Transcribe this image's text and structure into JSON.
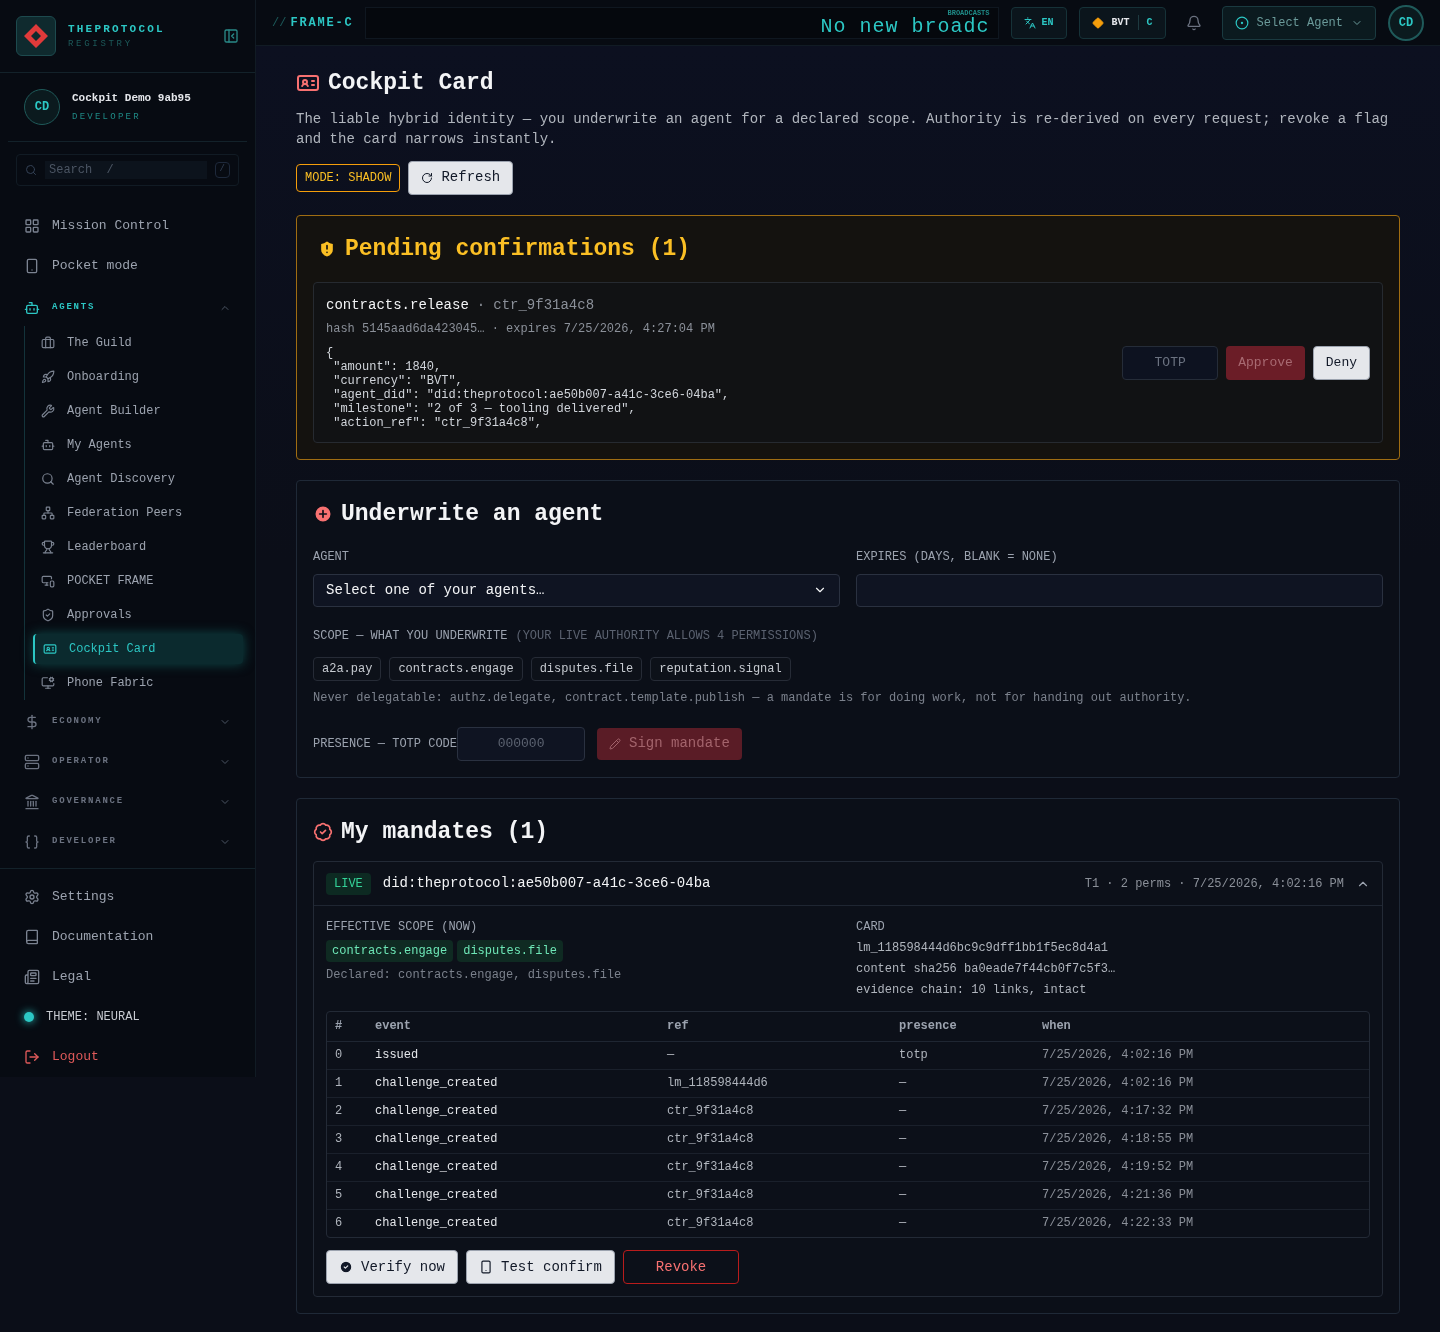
{
  "sidebar": {
    "brand": {
      "name": "THEPROTOCOL",
      "sub": "REGISTRY"
    },
    "user": {
      "initials": "CD",
      "name": "Cockpit Demo 9ab95",
      "role": "DEVELOPER"
    },
    "search": {
      "placeholder": "Search  /",
      "shortcut": "/"
    },
    "nav": [
      {
        "kind": "link",
        "label": "Mission Control",
        "selected": false
      },
      {
        "kind": "link",
        "label": "Pocket mode",
        "selected": false
      },
      {
        "kind": "group",
        "label": "AGENTS",
        "expanded": true,
        "children": [
          {
            "label": "The Guild",
            "selected": false
          },
          {
            "label": "Onboarding",
            "selected": false
          },
          {
            "label": "Agent Builder",
            "selected": false
          },
          {
            "label": "My Agents",
            "selected": false
          },
          {
            "label": "Agent Discovery",
            "selected": false
          },
          {
            "label": "Federation Peers",
            "selected": false
          },
          {
            "label": "Leaderboard",
            "selected": false
          },
          {
            "label": "POCKET FRAME",
            "selected": false
          },
          {
            "label": "Approvals",
            "selected": false
          },
          {
            "label": "Cockpit Card",
            "selected": true
          },
          {
            "label": "Phone Fabric",
            "selected": false
          }
        ]
      },
      {
        "kind": "group",
        "label": "ECONOMY",
        "expanded": false
      },
      {
        "kind": "group",
        "label": "OPERATOR",
        "expanded": false
      },
      {
        "kind": "group",
        "label": "GOVERNANCE",
        "expanded": false
      },
      {
        "kind": "group",
        "label": "DEVELOPER",
        "expanded": false
      }
    ],
    "footer": [
      "Settings",
      "Documentation",
      "Legal"
    ],
    "theme": "THEME: NEURAL",
    "logout": "Logout"
  },
  "topbar": {
    "prefix": "//",
    "title": "FRAME-C",
    "ticker_label": "BROADCASTS",
    "ticker": "No new broadc",
    "language": "EN",
    "token": "BVT",
    "token_suffix": "C",
    "agent_select": "Select Agent",
    "avatar": "CD"
  },
  "page": {
    "title": "Cockpit Card",
    "description": "The liable hybrid identity — you underwrite an agent for a declared scope. Authority is re-derived on every request; revoke a flag and the card narrows instantly.",
    "mode": "MODE: SHADOW",
    "refresh": "Refresh"
  },
  "pending": {
    "title": "Pending confirmations (1)",
    "items": [
      {
        "action": "contracts.release",
        "separator": "·",
        "ref": "ctr_9f31a4c8",
        "meta": "hash 5145aad6da423045… · expires 7/25/2026, 4:27:04 PM",
        "payload": [
          "{",
          "\"amount\": 1840,",
          "\"currency\": \"BVT\",",
          "\"agent_did\": \"did:theprotocol:ae50b007-a41c-3ce6-04ba\",",
          "\"milestone\": \"2 of 3 — tooling delivered\",",
          "\"action_ref\": \"ctr_9f31a4c8\","
        ],
        "totp_placeholder": "TOTP",
        "approve": {
          "label": "Approve",
          "disabled": true
        },
        "deny": "Deny"
      }
    ]
  },
  "underwrite": {
    "title": "Underwrite an agent",
    "agent_label": "AGENT",
    "agent_value": "Select one of your agents…",
    "expires_label": "EXPIRES (DAYS, BLANK = NONE)",
    "scope_label": "SCOPE — WHAT YOU UNDERWRITE",
    "scope_hint": "(YOUR LIVE AUTHORITY ALLOWS 4 PERMISSIONS)",
    "permissions": [
      {
        "label": "a2a.pay",
        "selected": false
      },
      {
        "label": "contracts.engage",
        "selected": false
      },
      {
        "label": "disputes.file",
        "selected": false
      },
      {
        "label": "reputation.signal",
        "selected": false
      }
    ],
    "note": "Never delegatable: authz.delegate, contract.template.publish — a mandate is for doing work, not for handing out authority.",
    "presence_label": "PRESENCE — TOTP CODE",
    "totp_placeholder": "000000",
    "sign": {
      "label": "Sign mandate",
      "disabled": true
    }
  },
  "mandates": {
    "title": "My mandates (1)",
    "items": [
      {
        "status": "LIVE",
        "did": "did:theprotocol:ae50b007-a41c-3ce6-04ba",
        "meta": "T1 · 2 perms · 7/25/2026, 4:02:16 PM",
        "expanded": true,
        "scope_label": "EFFECTIVE SCOPE (NOW)",
        "scope": [
          "contracts.engage",
          "disputes.file"
        ],
        "declared": "Declared: contracts.engage, disputes.file",
        "card_label": "CARD",
        "card": [
          "lm_118598444d6bc9c9dff1bb1f5ec8d4a1",
          "content sha256 ba0eade7f44cb0f7c5f3…",
          "evidence chain: 10 links, intact"
        ],
        "columns": [
          "#",
          "event",
          "ref",
          "presence",
          "when"
        ],
        "rows": [
          [
            "0",
            "issued",
            "—",
            "totp",
            "7/25/2026, 4:02:16 PM"
          ],
          [
            "1",
            "challenge_created",
            "lm_118598444d6",
            "—",
            "7/25/2026, 4:02:16 PM"
          ],
          [
            "2",
            "challenge_created",
            "ctr_9f31a4c8",
            "—",
            "7/25/2026, 4:17:32 PM"
          ],
          [
            "3",
            "challenge_created",
            "ctr_9f31a4c8",
            "—",
            "7/25/2026, 4:18:55 PM"
          ],
          [
            "4",
            "challenge_created",
            "ctr_9f31a4c8",
            "—",
            "7/25/2026, 4:19:52 PM"
          ],
          [
            "5",
            "challenge_created",
            "ctr_9f31a4c8",
            "—",
            "7/25/2026, 4:21:36 PM"
          ],
          [
            "6",
            "challenge_created",
            "ctr_9f31a4c8",
            "—",
            "7/25/2026, 4:22:33 PM"
          ]
        ],
        "verify": "Verify now",
        "test": "Test confirm",
        "revoke": "Revoke"
      }
    ]
  }
}
